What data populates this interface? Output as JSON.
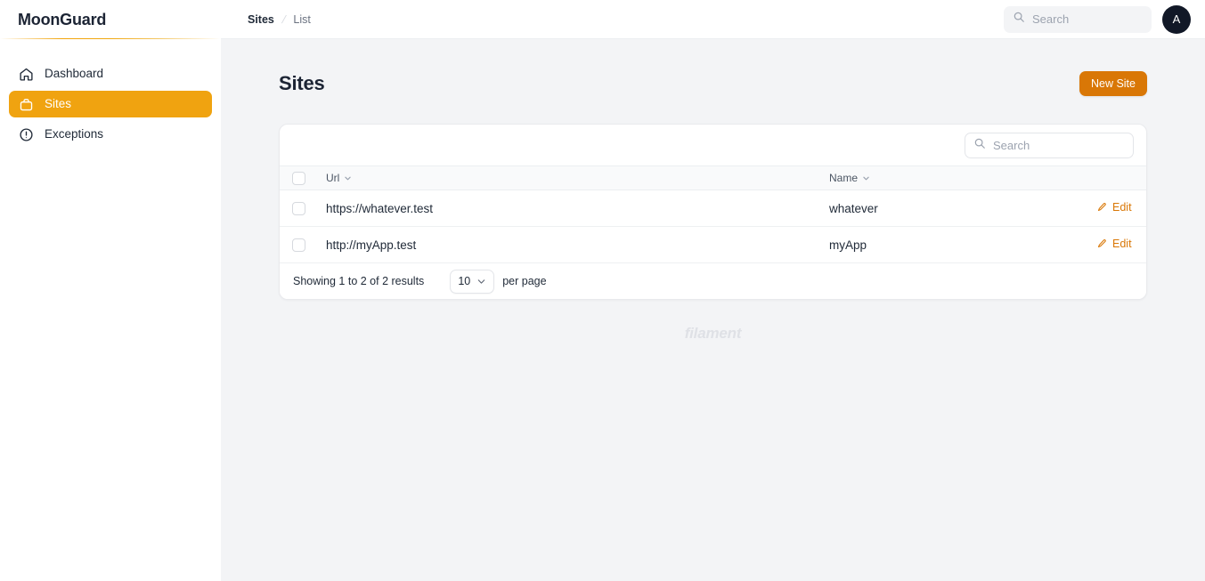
{
  "brand": {
    "name": "MoonGuard"
  },
  "sidebar": {
    "items": [
      {
        "label": "Dashboard",
        "icon": "home-icon",
        "active": false
      },
      {
        "label": "Sites",
        "icon": "briefcase-icon",
        "active": true
      },
      {
        "label": "Exceptions",
        "icon": "exclamation-circle-icon",
        "active": false
      }
    ]
  },
  "topbar": {
    "breadcrumb": {
      "current": "Sites",
      "separator": "/",
      "sub": "List"
    },
    "search": {
      "value": "",
      "placeholder": "Search"
    },
    "avatar": {
      "initial": "A"
    }
  },
  "page": {
    "title": "Sites",
    "new_button": "New Site"
  },
  "table": {
    "search": {
      "value": "",
      "placeholder": "Search"
    },
    "columns": [
      {
        "key": "url",
        "label": "Url",
        "sortable": true
      },
      {
        "key": "name",
        "label": "Name",
        "sortable": true
      }
    ],
    "rows": [
      {
        "url": "https://whatever.test",
        "name": "whatever",
        "action": "Edit"
      },
      {
        "url": "http://myApp.test",
        "name": "myApp",
        "action": "Edit"
      }
    ],
    "footer": {
      "results_text": "Showing 1 to 2 of 2 results",
      "per_page_value": "10",
      "per_page_label": "per page"
    }
  },
  "watermark": {
    "text": "filament"
  },
  "colors": {
    "accent": "#f0a310",
    "button": "#d97706",
    "page_bg": "#f3f4f6",
    "avatar_bg": "#111827"
  }
}
